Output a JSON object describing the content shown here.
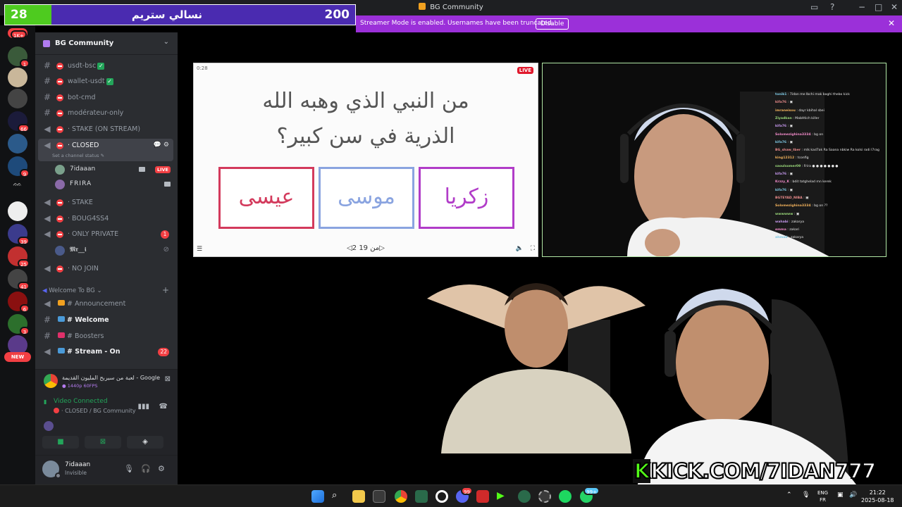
{
  "window": {
    "title": "BG Community",
    "controls": [
      "−",
      "□",
      "✕"
    ]
  },
  "score_overlay": {
    "left_value": "28",
    "title": "نسالي ستريم",
    "right_value": "200"
  },
  "streamer_banner": {
    "text": "Streamer Mode is enabled. Usernames have been truncated.",
    "button": "Disable"
  },
  "server_rail": {
    "badges": [
      "1K+",
      "1",
      "66",
      "9",
      "39",
      "25",
      "41",
      "6",
      "3"
    ],
    "new_label": "NEW"
  },
  "server": {
    "name": "BG Community"
  },
  "channels": [
    {
      "label": "usdt-bsc",
      "icon": "hash",
      "checked": true
    },
    {
      "label": "wallet-usdt",
      "icon": "hash",
      "checked": true
    },
    {
      "label": "bot-cmd",
      "icon": "hash"
    },
    {
      "label": "modérateur-only",
      "icon": "hash"
    },
    {
      "label": "STAKE (ON STREAM)",
      "icon": "speaker"
    },
    {
      "label": "CLOSED",
      "icon": "speaker",
      "active": true,
      "status": "Set a channel status"
    },
    {
      "label": "STAKE",
      "icon": "speaker"
    },
    {
      "label": "BOUG4SS4",
      "icon": "speaker"
    },
    {
      "label": "ONLY PRIVATE",
      "icon": "speaker",
      "badge": "1"
    },
    {
      "label": "NO JOIN",
      "icon": "speaker"
    }
  ],
  "voice_users": [
    {
      "name": "7idaaan",
      "live": "LIVE"
    },
    {
      "name": "FRIRA"
    },
    {
      "name": "𝕸𝖗__𝖎"
    }
  ],
  "category": {
    "label": "Welcome To BG",
    "items": [
      {
        "label": "# Announcement",
        "icon": "speaker"
      },
      {
        "label": "# Welcome",
        "icon": "hash",
        "bold": true
      },
      {
        "label": "# Boosters",
        "icon": "hash"
      },
      {
        "label": "# Stream - On",
        "icon": "speaker",
        "bold": true,
        "badge": "22"
      }
    ]
  },
  "activity": {
    "title": "لعبة من سيربح المليون القديمة - Google Chrome",
    "subtitle": "1440p 60FPS"
  },
  "voice_panel": {
    "status": "Video Connected",
    "channel": "CLOSED / BG Community"
  },
  "user": {
    "name": "7idaaan",
    "status": "Invisible"
  },
  "quiz": {
    "time": "0:28",
    "live": "LIVE",
    "question_line1": "من النبي الذي وهبه الله",
    "question_line2": "الذرية في سن كبير؟",
    "options": [
      {
        "text": "عيسى",
        "color": "#d33a5c"
      },
      {
        "text": "موسى",
        "color": "#8aa4e0"
      },
      {
        "text": "زكريا",
        "color": "#b13cc8"
      }
    ],
    "nav": "◁2 من 19▷"
  },
  "chat": [
    {
      "user": "tonik1",
      "msg": "7idan me lbchi mak baghi thebo kick"
    },
    {
      "user": "kifa76",
      "msg": "▣"
    },
    {
      "user": "imraneisou",
      "msg": "dayr kbihal sbei"
    },
    {
      "user": "Ziyadkan",
      "msg": "MabHtich killer"
    },
    {
      "user": "kifa76",
      "msg": "▣"
    },
    {
      "user": "Solomezighina3334",
      "msg": "bg on"
    },
    {
      "user": "kifa76",
      "msg": "▣"
    },
    {
      "user": "BG_shaw_tber",
      "msg": "mlk kad7ak Ra Saana nbkiw Ra kolsi radi l7rag"
    },
    {
      "user": "king12312",
      "msg": "tconfig"
    },
    {
      "user": "saoulsomer09",
      "msg": "Frira ● ● ● ● ● ● ●"
    },
    {
      "user": "kifa76",
      "msg": "▣"
    },
    {
      "user": "Krzzy_K",
      "msg": "bdit tatghelad mn kerek"
    },
    {
      "user": "kifa76",
      "msg": "▣"
    },
    {
      "user": "BGTEYAD_NIBA",
      "msg": "▣"
    },
    {
      "user": "Solomezighina3334",
      "msg": "bg on ??"
    },
    {
      "user": "wwwwww",
      "msg": "▣"
    },
    {
      "user": "wahabi",
      "msg": "zakarya"
    },
    {
      "user": "emma",
      "msg": "zakari"
    },
    {
      "user": "ahmad",
      "msg": "zakarya"
    }
  ],
  "kick_overlay": {
    "badge": "K",
    "text": "KICK.COM/7IDAN777"
  },
  "taskbar": {
    "lang_line1": "ENG",
    "lang_line2": "FR",
    "time": "21:22",
    "date": "2025-08-18",
    "discord_badge": "99",
    "whatsapp_badge": "99+"
  }
}
